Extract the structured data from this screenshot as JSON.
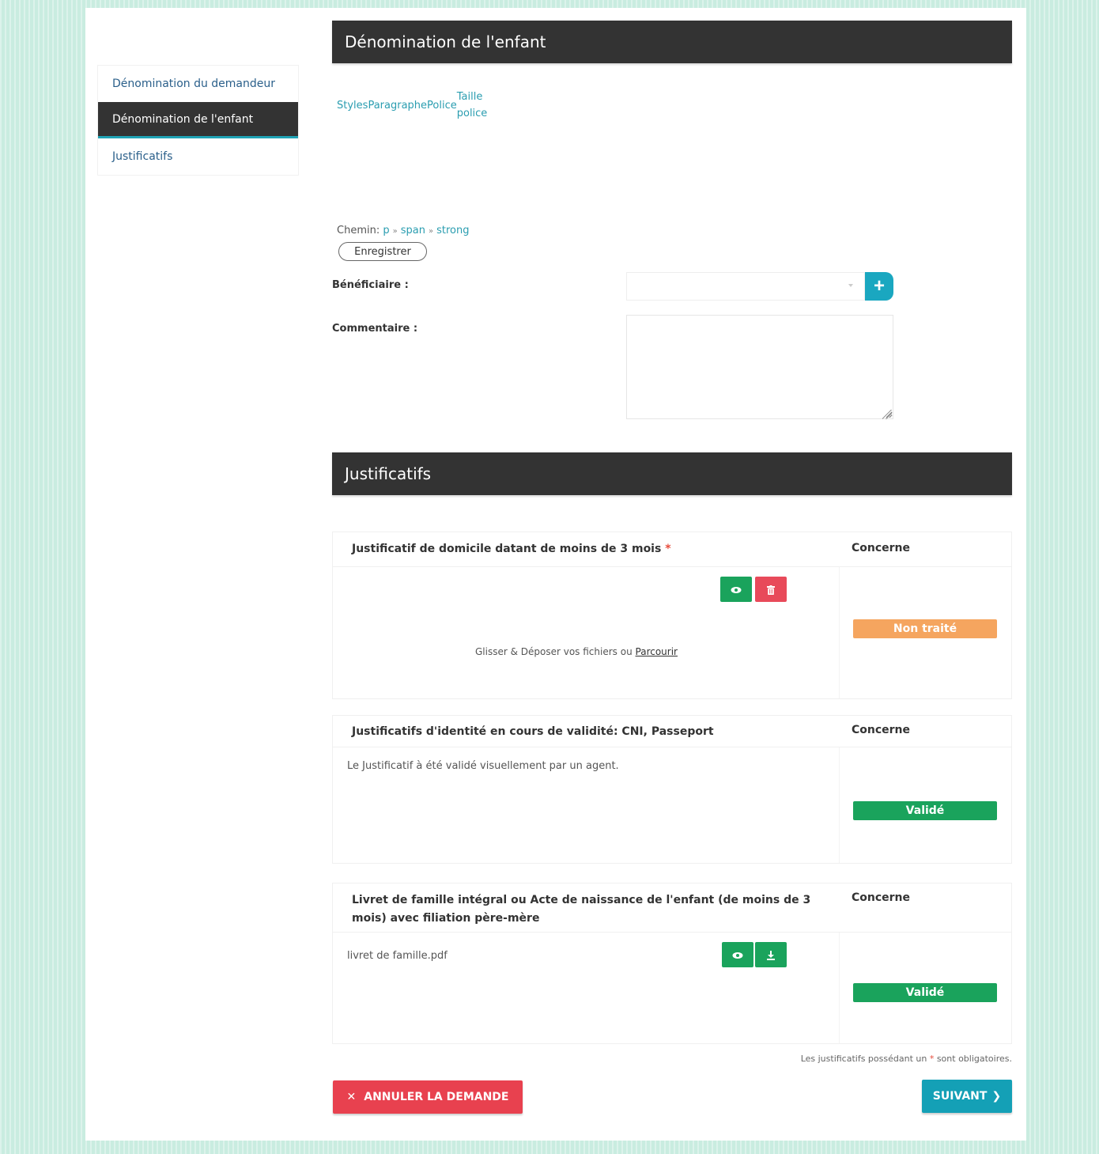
{
  "sidebar": {
    "items": [
      {
        "label": "Dénomination du demandeur"
      },
      {
        "label": "Dénomination de l'enfant"
      },
      {
        "label": "Justificatifs"
      }
    ]
  },
  "enfant_section": {
    "title": "Dénomination de l'enfant",
    "toolbar": {
      "styles": "Styles",
      "paragraphe": "Paragraphe",
      "police": "Police",
      "taille_line1": "Taille",
      "taille_line2": "police"
    },
    "path": {
      "label": "Chemin:",
      "items": [
        "p",
        "span",
        "strong"
      ],
      "separator": "»"
    },
    "save_label": "Enregistrer",
    "beneficiaire_label": "Bénéficiaire :",
    "commentaire_label": "Commentaire :",
    "plus_icon": "+"
  },
  "justif_section": {
    "title": "Justificatifs",
    "concerne_label": "Concerne",
    "cards": [
      {
        "title": "Justificatif de domicile datant de moins de 3 mois",
        "required_mark": "*",
        "drop_text": "Glisser & Déposer vos fichiers ou",
        "browse_label": "Parcourir",
        "status": "Non traité",
        "status_color": "#f5a55f"
      },
      {
        "title": "Justificatifs d'identité en cours de validité: CNI, Passeport",
        "message": "Le Justificatif à été validé visuellement par un agent.",
        "status": "Validé",
        "status_color": "#1aa35c"
      },
      {
        "title": "Livret de famille intégral ou Acte de naissance de l'enfant (de moins de 3 mois) avec filiation père-mère",
        "file_name": "livret de famille.pdf",
        "status": "Validé",
        "status_color": "#1aa35c"
      }
    ],
    "footnote_before": "Les justificatifs possédant un",
    "footnote_mark": "*",
    "footnote_after": "sont obligatoires."
  },
  "actions": {
    "cancel_icon": "✕",
    "cancel_label": "ANNULER LA DEMANDE",
    "next_label": "SUIVANT",
    "next_icon": "❯"
  },
  "colors": {
    "header_bg": "#333333",
    "accent": "#14a0b6",
    "danger": "#e8414f",
    "success": "#1aa35c",
    "warning": "#f5a55f"
  }
}
